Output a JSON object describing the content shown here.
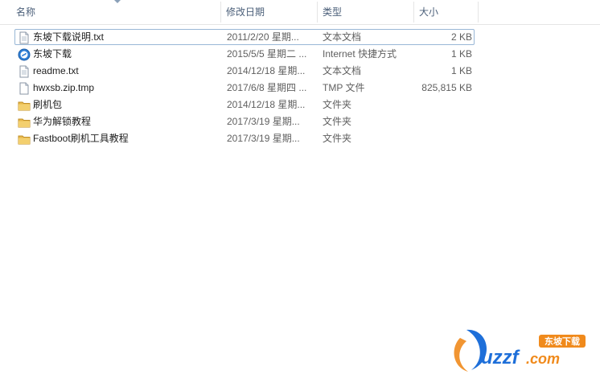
{
  "columns": {
    "name": "名称",
    "date": "修改日期",
    "type": "类型",
    "size": "大小"
  },
  "files": [
    {
      "name": "东坡下载说明.txt",
      "date": "2011/2/20 星期...",
      "type": "文本文档",
      "size": "2 KB",
      "icon": "text-file-icon"
    },
    {
      "name": "东坡下载",
      "date": "2015/5/5 星期二 ...",
      "type": "Internet 快捷方式",
      "size": "1 KB",
      "icon": "internet-shortcut-icon"
    },
    {
      "name": "readme.txt",
      "date": "2014/12/18 星期...",
      "type": "文本文档",
      "size": "1 KB",
      "icon": "text-file-icon"
    },
    {
      "name": "hwxsb.zip.tmp",
      "date": "2017/6/8 星期四 ...",
      "type": "TMP 文件",
      "size": "825,815 KB",
      "icon": "blank-file-icon"
    },
    {
      "name": "刷机包",
      "date": "2014/12/18 星期...",
      "type": "文件夹",
      "size": "",
      "icon": "folder-icon"
    },
    {
      "name": "华为解锁教程",
      "date": "2017/3/19 星期...",
      "type": "文件夹",
      "size": "",
      "icon": "folder-icon"
    },
    {
      "name": "Fastboot刷机工具教程",
      "date": "2017/3/19 星期...",
      "type": "文件夹",
      "size": "",
      "icon": "folder-icon"
    }
  ],
  "watermark": {
    "brand": "uzzf.com",
    "tagline": "东坡下载"
  },
  "colors": {
    "header_text": "#4c607a",
    "focus_border": "#99b7d6",
    "folder": "#e8b84a",
    "brand_blue": "#1e6fd9",
    "brand_orange": "#f08a1c"
  }
}
